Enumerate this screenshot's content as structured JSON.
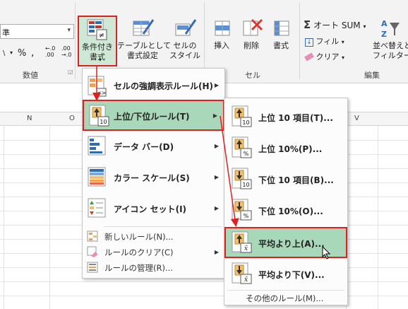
{
  "ribbon": {
    "number_format_value": "準",
    "percent_symbol": "%",
    "comma_symbol": ",",
    "currency_symbol": "\\",
    "increase_decimal": "←.0\n.00",
    "decrease_decimal": ".00\n→.0",
    "group_number_label": "数値",
    "conditional_formatting_label": "条件付き\n書式",
    "format_as_table_label": "テーブルとして\n書式設定",
    "cell_styles_label": "セルの\nスタイル",
    "insert_label": "挿入",
    "delete_label": "削除",
    "format_label": "書式",
    "group_cells_label": "セル",
    "autosum_label": "オート SUM",
    "fill_label": "フィル",
    "clear_label": "クリア",
    "sort_filter_label": "並べ替えと\nフィルター",
    "group_editing_label": "編集"
  },
  "sheet": {
    "column_headers": [
      "N",
      "O",
      "V"
    ]
  },
  "main_menu": {
    "items": [
      {
        "label": "セルの強調表示ルール(H)",
        "icon": "highlight-cells-icon"
      },
      {
        "label": "上位/下位ルール(T)",
        "icon": "top-bottom-rules-icon"
      },
      {
        "label": "データ バー(D)",
        "icon": "data-bars-icon"
      },
      {
        "label": "カラー スケール(S)",
        "icon": "color-scales-icon"
      },
      {
        "label": "アイコン セット(I)",
        "icon": "icon-sets-icon"
      }
    ],
    "small_items": [
      {
        "label": "新しいルール(N)...",
        "icon": "new-rule-icon"
      },
      {
        "label": "ルールのクリア(C)",
        "icon": "clear-rules-icon"
      },
      {
        "label": "ルールの管理(R)...",
        "icon": "manage-rules-icon"
      }
    ]
  },
  "sub_menu": {
    "items": [
      {
        "label": "上位 10 項目(T)...",
        "badge": "10",
        "icon": "top-10-items-icon"
      },
      {
        "label": "上位 10%(P)...",
        "badge": "%",
        "icon": "top-10-percent-icon"
      },
      {
        "label": "下位 10 項目(B)...",
        "badge": "10",
        "icon": "bottom-10-items-icon"
      },
      {
        "label": "下位 10%(O)...",
        "badge": "%",
        "icon": "bottom-10-percent-icon"
      },
      {
        "label": "平均より上(A)...",
        "badge": "x̄",
        "icon": "above-average-icon"
      },
      {
        "label": "平均より下(V)...",
        "badge": "x̄",
        "icon": "below-average-icon"
      }
    ],
    "more_rules": "その他のルール(M)..."
  },
  "colors": {
    "highlight_fill": "#a8d8b9",
    "highlight_border": "#e0201f",
    "ribbon_bg": "#f3f3f3"
  }
}
